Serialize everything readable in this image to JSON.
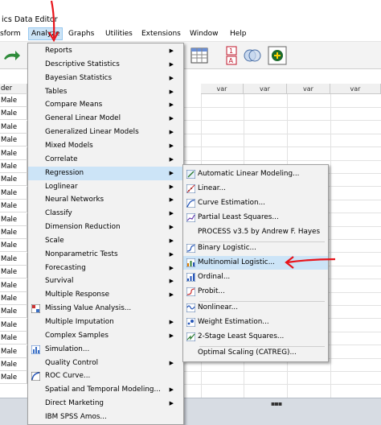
{
  "window": {
    "title": "ics Data Editor"
  },
  "menubar": {
    "items": [
      {
        "label": "sform"
      },
      {
        "label": "Analyze"
      },
      {
        "label": "Graphs"
      },
      {
        "label": "Utilities"
      },
      {
        "label": "Extensions"
      },
      {
        "label": "Window"
      },
      {
        "label": "Help"
      }
    ]
  },
  "grid": {
    "row_header_label": "der",
    "columns": [
      "var",
      "var",
      "var",
      "var",
      "var"
    ],
    "rows": [
      "Male",
      "Male",
      "Male",
      "Male",
      "Male",
      "Male",
      "Male",
      "Male",
      "Male",
      "Male",
      "Male",
      "Male",
      "Male",
      "Male",
      "Male",
      "Male",
      "Male",
      "Male",
      "Male",
      "Male",
      "Male",
      "Male"
    ]
  },
  "analyze_menu": {
    "items": [
      {
        "label": "Reports",
        "submenu": true
      },
      {
        "label": "Descriptive Statistics",
        "submenu": true
      },
      {
        "label": "Bayesian Statistics",
        "submenu": true
      },
      {
        "label": "Tables",
        "submenu": true
      },
      {
        "label": "Compare Means",
        "submenu": true
      },
      {
        "label": "General Linear Model",
        "submenu": true
      },
      {
        "label": "Generalized Linear Models",
        "submenu": true
      },
      {
        "label": "Mixed Models",
        "submenu": true
      },
      {
        "label": "Correlate",
        "submenu": true
      },
      {
        "label": "Regression",
        "submenu": true,
        "highlighted": true
      },
      {
        "label": "Loglinear",
        "submenu": true
      },
      {
        "label": "Neural Networks",
        "submenu": true
      },
      {
        "label": "Classify",
        "submenu": true
      },
      {
        "label": "Dimension Reduction",
        "submenu": true
      },
      {
        "label": "Scale",
        "submenu": true
      },
      {
        "label": "Nonparametric Tests",
        "submenu": true
      },
      {
        "label": "Forecasting",
        "submenu": true
      },
      {
        "label": "Survival",
        "submenu": true
      },
      {
        "label": "Multiple Response",
        "submenu": true
      },
      {
        "label": "Missing Value Analysis...",
        "submenu": false,
        "icon": "missing-value-icon"
      },
      {
        "label": "Multiple Imputation",
        "submenu": true
      },
      {
        "label": "Complex Samples",
        "submenu": true
      },
      {
        "label": "Simulation...",
        "submenu": false,
        "icon": "simulation-icon"
      },
      {
        "label": "Quality Control",
        "submenu": true
      },
      {
        "label": "ROC Curve...",
        "submenu": false,
        "icon": "roc-curve-icon"
      },
      {
        "label": "Spatial and Temporal Modeling...",
        "submenu": true
      },
      {
        "label": "Direct Marketing",
        "submenu": true
      },
      {
        "label": "IBM SPSS Amos...",
        "submenu": false
      }
    ]
  },
  "regression_menu": {
    "items": [
      {
        "label": "Automatic Linear Modeling...",
        "icon": "auto-linear-icon"
      },
      {
        "label": "Linear...",
        "icon": "linear-icon"
      },
      {
        "label": "Curve Estimation...",
        "icon": "curve-estimation-icon"
      },
      {
        "label": "Partial Least Squares...",
        "icon": "pls-icon"
      },
      {
        "label": "PROCESS v3.5 by Andrew F. Hayes",
        "icon": ""
      },
      {
        "label": "Binary Logistic...",
        "icon": "binary-logistic-icon"
      },
      {
        "label": "Multinomial Logistic...",
        "icon": "multinomial-logistic-icon",
        "highlighted": true
      },
      {
        "label": "Ordinal...",
        "icon": "ordinal-icon"
      },
      {
        "label": "Probit...",
        "icon": "probit-icon"
      },
      {
        "label": "Nonlinear...",
        "icon": "nonlinear-icon"
      },
      {
        "label": "Weight Estimation...",
        "icon": "weight-estimation-icon"
      },
      {
        "label": "2-Stage Least Squares...",
        "icon": "two-stage-icon"
      },
      {
        "label": "Optimal Scaling (CATREG)...",
        "icon": ""
      }
    ]
  },
  "colors": {
    "highlight": "#cce4f7",
    "annotation": "#e8141b",
    "menu_bg": "#f2f2f2"
  }
}
